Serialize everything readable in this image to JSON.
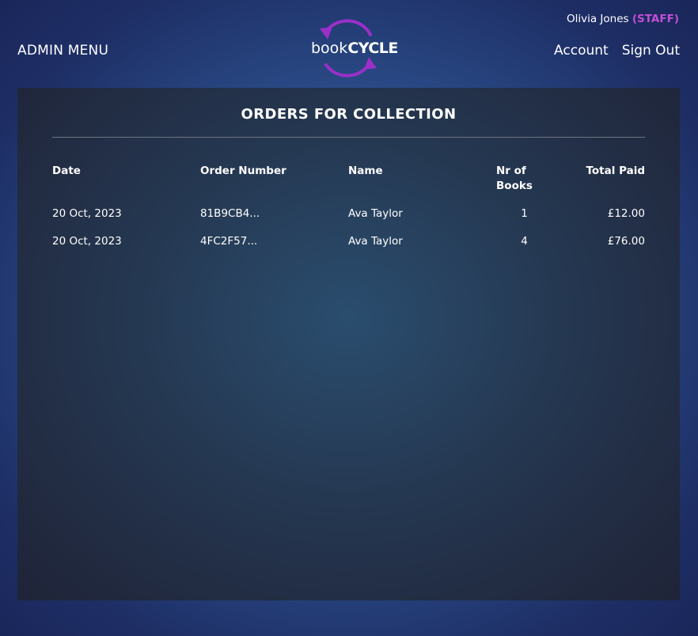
{
  "header": {
    "admin_menu_label": "ADMIN MENU",
    "user_name": "Olivia Jones",
    "user_role": "(STAFF)",
    "account_label": "Account",
    "sign_out_label": "Sign Out",
    "logo": {
      "text_book": "book",
      "text_cycle": "CYCLE",
      "accent_color": "#9b2fc8"
    }
  },
  "main": {
    "title": "ORDERS FOR COLLECTION",
    "table": {
      "columns": [
        "Date",
        "Order Number",
        "Name",
        "Nr of Books",
        "Total Paid"
      ],
      "rows": [
        {
          "date": "20 Oct, 2023",
          "order_number": "81B9CB4...",
          "name": "Ava Taylor",
          "nr_books": "1",
          "total_paid": "£12.00"
        },
        {
          "date": "20 Oct, 2023",
          "order_number": "4FC2F57...",
          "name": "Ava Taylor",
          "nr_books": "4",
          "total_paid": "£76.00"
        }
      ]
    }
  },
  "colors": {
    "staff_badge": "#c24fd6",
    "logo_accent": "#9b2fc8"
  }
}
